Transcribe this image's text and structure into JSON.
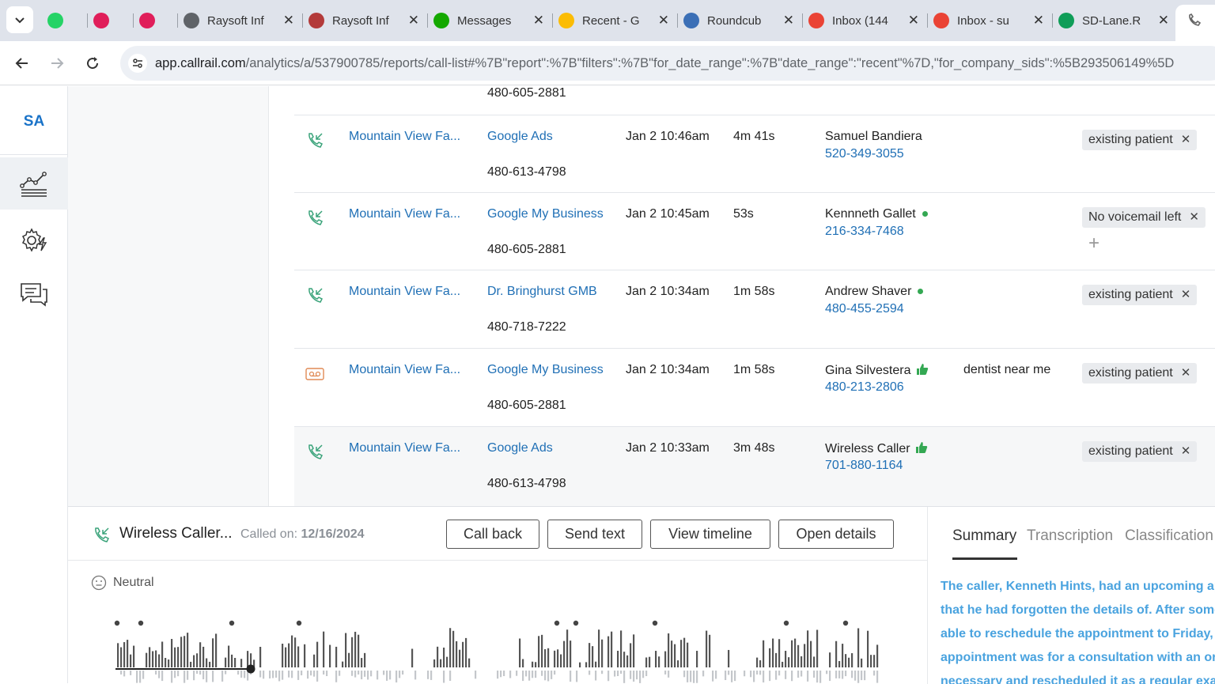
{
  "browser": {
    "tabs": [
      {
        "title": "",
        "favicon": "whatsapp-icon",
        "color": "#25d366"
      },
      {
        "title": "",
        "favicon": "slack-icon",
        "color": "#e01e5a"
      },
      {
        "title": "",
        "favicon": "slack-icon",
        "color": "#e01e5a"
      },
      {
        "title": "Raysoft Inf",
        "favicon": "globe-icon",
        "color": "#5f6368"
      },
      {
        "title": "Raysoft Inf",
        "favicon": "raysoft-icon",
        "color": "#b33a3a"
      },
      {
        "title": "Messages",
        "favicon": "upwork-icon",
        "color": "#14a800"
      },
      {
        "title": "Recent - G",
        "favicon": "google-drive-icon",
        "color": "#fbbc04"
      },
      {
        "title": "Roundcub",
        "favicon": "roundcube-icon",
        "color": "#3b6fb6"
      },
      {
        "title": "Inbox (144",
        "favicon": "gmail-icon",
        "color": "#ea4335"
      },
      {
        "title": "Inbox - su",
        "favicon": "gmail-icon",
        "color": "#ea4335"
      },
      {
        "title": "SD-Lane.R",
        "favicon": "sheets-icon",
        "color": "#0f9d58"
      }
    ],
    "url_host": "app.callrail.com",
    "url_path": "/analytics/a/537900785/reports/call-list#%7B\"report\":%7B\"filters\":%7B\"for_date_range\":%7B\"date_range\":\"recent\"%7D,\"for_company_sids\":%5B293506149%5D"
  },
  "rail": {
    "avatar": "SA",
    "items": [
      "analytics-icon",
      "settings-bolt-icon",
      "conversations-icon"
    ]
  },
  "top_partial_row": {
    "tracking": "480-605-2881"
  },
  "calls": [
    {
      "type": "inbound",
      "company": "Mountain View Fa...",
      "source": "Google Ads",
      "tracking": "480-613-4798",
      "date": "Jan 2 10:46am",
      "duration": "4m 41s",
      "caller": "Samuel Bandiera",
      "phone": "520-349-3055",
      "indicator": "",
      "keyword": "",
      "tag": "existing patient",
      "plus": false
    },
    {
      "type": "inbound",
      "company": "Mountain View Fa...",
      "source": "Google My Business",
      "tracking": "480-605-2881",
      "date": "Jan 2 10:45am",
      "duration": "53s",
      "caller": "Kennneth Gallet",
      "phone": "216-334-7468",
      "indicator": "dot",
      "keyword": "",
      "tag": "No voicemail left",
      "plus": true
    },
    {
      "type": "inbound",
      "company": "Mountain View Fa...",
      "source": "Dr. Bringhurst GMB",
      "tracking": "480-718-7222",
      "date": "Jan 2 10:34am",
      "duration": "1m 58s",
      "caller": "Andrew Shaver",
      "phone": "480-455-2594",
      "indicator": "dot",
      "keyword": "",
      "tag": "existing patient",
      "plus": false
    },
    {
      "type": "voicemail",
      "company": "Mountain View Fa...",
      "source": "Google My Business",
      "tracking": "480-605-2881",
      "date": "Jan 2 10:34am",
      "duration": "1m 58s",
      "caller": "Gina Silvestera",
      "phone": "480-213-2806",
      "indicator": "thumb",
      "keyword": "dentist near me",
      "tag": "existing patient",
      "plus": false
    },
    {
      "type": "inbound",
      "company": "Mountain View Fa...",
      "source": "Google Ads",
      "tracking": "480-613-4798",
      "date": "Jan 2 10:33am",
      "duration": "3m 48s",
      "caller": "Wireless Caller",
      "phone": "701-880-1164",
      "indicator": "thumb",
      "keyword": "",
      "tag": "existing patient",
      "plus": false
    }
  ],
  "detail": {
    "caller": "Wireless Caller...",
    "called_on_label": "Called on:",
    "called_on_date": "12/16/2024",
    "buttons": {
      "call_back": "Call back",
      "send_text": "Send text",
      "view_timeline": "View timeline",
      "open_details": "Open details"
    },
    "sentiment": "Neutral",
    "tabs": {
      "summary": "Summary",
      "transcription": "Transcription",
      "classification": "Classification"
    },
    "summary_lines": [
      "The caller, Kenneth Hints, had an upcoming ap",
      "that he had forgotten the details of. After some",
      "able to reschedule the appointment to Friday, I",
      "appointment was for a consultation with an or",
      "necessary and rescheduled it as a regular exam"
    ],
    "playback_progress": 0.18
  },
  "colors": {
    "accent": "#1f6fb5",
    "green": "#34a853",
    "summary_text": "#4aa3df"
  }
}
